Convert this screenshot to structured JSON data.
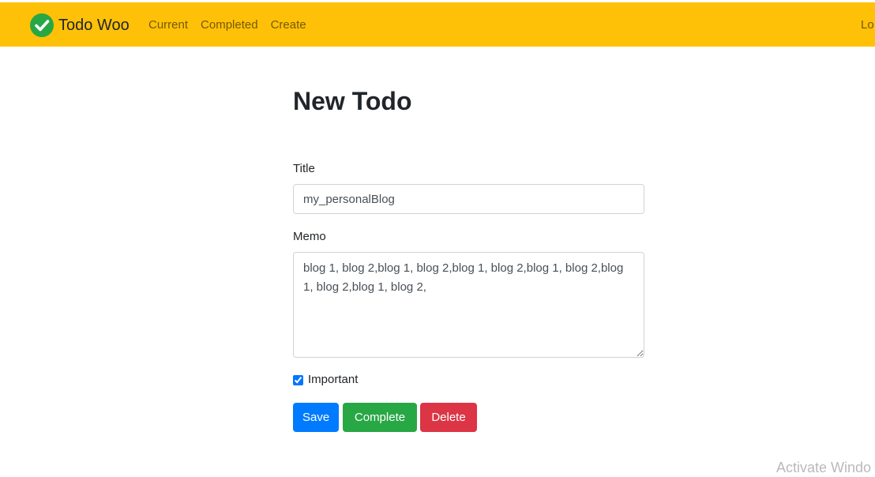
{
  "navbar": {
    "brand_label": "Todo Woo",
    "brand_icon": "check-circle-icon",
    "links": [
      {
        "label": "Current"
      },
      {
        "label": "Completed"
      },
      {
        "label": "Create"
      }
    ],
    "right_label": "Lo",
    "background_color": "#ffc107"
  },
  "main": {
    "heading": "New Todo",
    "title_field": {
      "label": "Title",
      "value": "my_personalBlog"
    },
    "memo_field": {
      "label": "Memo",
      "value": "blog 1, blog 2,blog 1, blog 2,blog 1, blog 2,blog 1, blog 2,blog 1, blog 2,blog 1, blog 2,"
    },
    "important": {
      "label": "Important",
      "checked": true
    },
    "buttons": {
      "save_label": "Save",
      "complete_label": "Complete",
      "delete_label": "Delete"
    },
    "colors": {
      "save": "#007bff",
      "complete": "#28a745",
      "delete": "#dc3545"
    }
  },
  "overlay": {
    "watermark": "Activate Windo"
  }
}
